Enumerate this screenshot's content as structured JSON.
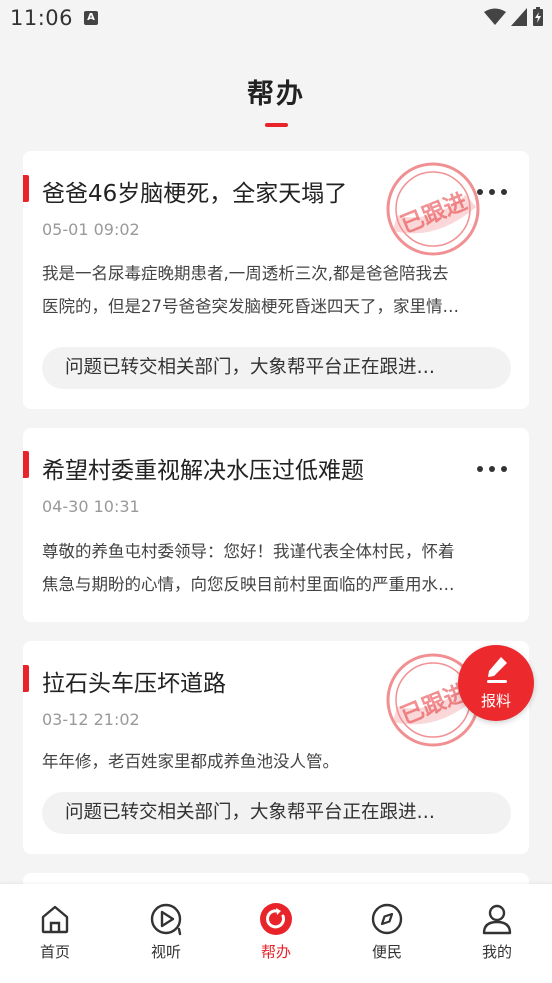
{
  "status_bar": {
    "time": "11:06",
    "notification_badge": "A"
  },
  "header": {
    "title": "帮办"
  },
  "posts": [
    {
      "title": "爸爸46岁脑梗死，全家天塌了",
      "date": "05-01 09:02",
      "body_lines": [
        "我是一名尿毒症晚期患者,一周透析三次,都是爸爸陪我去",
        "医院的，但是27号爸爸突发脑梗死昏迷四天了，家里情…"
      ],
      "status": "问题已转交相关部门，大象帮平台正在跟进…",
      "stamp": "已跟进"
    },
    {
      "title": "希望村委重视解决水压过低难题",
      "date": "04-30 10:31",
      "body_lines": [
        "尊敬的养鱼屯村委领导：您好！我谨代表全体村民，怀着",
        "焦急与期盼的心情，向您反映目前村里面临的严重用水…"
      ]
    },
    {
      "title": "拉石头车压坏道路",
      "date": "03-12 21:02",
      "body_lines": [
        "年年修，老百姓家里都成养鱼池没人管。"
      ],
      "status": "问题已转交相关部门，大象帮平台正在跟进…",
      "stamp": "已跟进"
    }
  ],
  "fab": {
    "label": "报料",
    "icon": "pen-icon"
  },
  "tabbar": {
    "tabs": [
      {
        "label": "首页",
        "icon": "home-icon"
      },
      {
        "label": "视听",
        "icon": "play-icon"
      },
      {
        "label": "帮办",
        "icon": "help-icon",
        "active": true
      },
      {
        "label": "便民",
        "icon": "compass-icon"
      },
      {
        "label": "我的",
        "icon": "user-icon"
      }
    ]
  },
  "colors": {
    "accent": "#e8242a",
    "background": "#f4f4f4",
    "card": "#ffffff",
    "muted_text": "#999999"
  }
}
